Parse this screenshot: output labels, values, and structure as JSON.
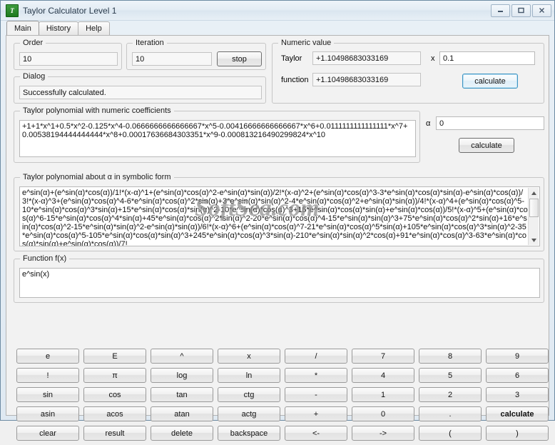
{
  "window": {
    "title": "Taylor Calculator Level 1",
    "icon": "app-icon-taylor",
    "minimize": "minimize-icon",
    "maximize": "maximize-icon",
    "close": "close-icon"
  },
  "tabs": [
    {
      "label": "Main",
      "active": true
    },
    {
      "label": "History",
      "active": false
    },
    {
      "label": "Help",
      "active": false
    }
  ],
  "order": {
    "legend": "Order",
    "value": "10"
  },
  "iteration": {
    "legend": "Iteration",
    "value": "10",
    "stop_label": "stop"
  },
  "dialog": {
    "legend": "Dialog",
    "value": "Successfully calculated."
  },
  "numeric_value": {
    "legend": "Numeric value",
    "taylor_label": "Taylor",
    "taylor_value": "+1.10498683033169",
    "function_label": "function",
    "function_value": "+1.10498683033169",
    "x_label": "x",
    "x_value": "0.1",
    "calculate_label": "calculate"
  },
  "numeric_poly": {
    "legend": "Taylor polynomial with numeric coefficients",
    "value": "+1+1*x^1+0.5*x^2-0.125*x^4-0.0666666666666667*x^5-0.00416666666666667*x^6+0.0111111111111111*x^7+0.00538194444444444*x^8+0.00017636684303351*x^9-0.000813216490299824*x^10",
    "alpha_label": "α",
    "alpha_value": "0",
    "calculate_label": "calculate"
  },
  "symbolic_poly": {
    "legend": "Taylor polynomial about α in symbolic form",
    "value": "e^sin(α)+(e^sin(α)*cos(α))/1!*(x-α)^1+(e^sin(α)*cos(α)^2-e^sin(α)*sin(α))/2!*(x-α)^2+(e^sin(α)*cos(α)^3-3*e^sin(α)*cos(α)*sin(α)-e^sin(α)*cos(α))/3!*(x-α)^3+(e^sin(α)*cos(α)^4-6*e^sin(α)*cos(α)^2*sin(α)+3*e^sin(α)*sin(α)^2-4*e^sin(α)*cos(α)^2+e^sin(α)*sin(α))/4!*(x-α)^4+(e^sin(α)*cos(α)^5-10*e^sin(α)*cos(α)^3*sin(α)+15*e^sin(α)*cos(α)*sin(α)^2-10*e^sin(α)*cos(α)^3+15*e^sin(α)*cos(α)*sin(α)+e^sin(α)*cos(α))/5!*(x-α)^5+(e^sin(α)*cos(α)^6-15*e^sin(α)*cos(α)^4*sin(α)+45*e^sin(α)*cos(α)^2*sin(α)^2-20*e^sin(α)*cos(α)^4-15*e^sin(α)*sin(α)^3+75*e^sin(α)*cos(α)^2*sin(α)+16*e^sin(α)*cos(α)^2-15*e^sin(α)*sin(α)^2-e^sin(α)*sin(α))/6!*(x-α)^6+(e^sin(α)*cos(α)^7-21*e^sin(α)*cos(α)^5*sin(α)+105*e^sin(α)*cos(α)^3*sin(α)^2-35*e^sin(α)*cos(α)^5-105*e^sin(α)*cos(α)*sin(α)^3+245*e^sin(α)*cos(α)^3*sin(α)-210*e^sin(α)*sin(α)^2*cos(α)+91*e^sin(α)*cos(α)^3-63*e^sin(α)*cos(α)*sin(α)+e^sin(α)*cos(α))/7!",
    "watermark": "SoftSea.com"
  },
  "function_fx": {
    "legend": "Function f(x)",
    "value": "e^sin(x)"
  },
  "keypad": {
    "rows": [
      [
        "e",
        "E",
        "^",
        "x",
        "/",
        "7",
        "8",
        "9"
      ],
      [
        "!",
        "π",
        "log",
        "ln",
        "*",
        "4",
        "5",
        "6"
      ],
      [
        "sin",
        "cos",
        "tan",
        "ctg",
        "-",
        "1",
        "2",
        "3"
      ],
      [
        "asin",
        "acos",
        "atan",
        "actg",
        "+",
        "0",
        ".",
        "calculate"
      ],
      [
        "clear",
        "result",
        "delete",
        "backspace",
        "<-",
        "->",
        "(",
        ")"
      ]
    ]
  }
}
